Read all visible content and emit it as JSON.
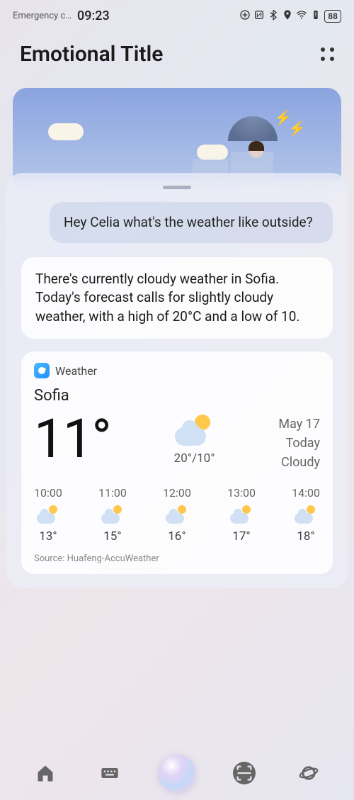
{
  "status": {
    "carrier": "Emergency c…",
    "time": "09:23",
    "battery": "88"
  },
  "header": {
    "title": "Emotional Title"
  },
  "conversation": {
    "user_message": "Hey Celia what's the weather like outside?",
    "assistant_message": "There's currently cloudy weather in Sofia. Today's forecast calls for slightly cloudy weather, with a high of 20°C and a low of 10."
  },
  "weather": {
    "app_label": "Weather",
    "city": "Sofia",
    "current_temp": "11°",
    "hi_lo": "20°/10°",
    "date": "May 17",
    "day": "Today",
    "condition": "Cloudy",
    "hourly": [
      {
        "time": "10:00",
        "temp": "13°"
      },
      {
        "time": "11:00",
        "temp": "15°"
      },
      {
        "time": "12:00",
        "temp": "16°"
      },
      {
        "time": "13:00",
        "temp": "17°"
      },
      {
        "time": "14:00",
        "temp": "18°"
      }
    ],
    "source": "Source: Huafeng-AccuWeather"
  }
}
